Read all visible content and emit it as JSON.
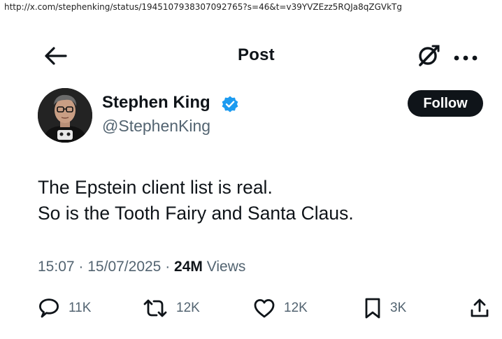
{
  "browser": {
    "url": "http://x.com/stephenking/status/1945107938307092765?s=46&t=v39YVZEzz5RQJa8qZGVkTg"
  },
  "header": {
    "title": "Post",
    "back_icon": "arrow-left-icon",
    "grok_icon": "grok-icon",
    "more_icon": "more-horizontal-icon"
  },
  "author": {
    "name": "Stephen King",
    "handle": "@StephenKing",
    "verified": true,
    "verified_color": "#1d9bf0",
    "avatar_icon": "avatar-photo"
  },
  "follow_button": {
    "label": "Follow"
  },
  "tweet": {
    "lines": [
      "The Epstein client list is real.",
      "So is the Tooth Fairy and Santa Claus."
    ]
  },
  "meta": {
    "time": "15:07",
    "separator": "·",
    "date": "15/07/2025",
    "views_count": "24M",
    "views_label": "Views"
  },
  "actions": {
    "reply": {
      "icon": "reply-icon",
      "count": "11K"
    },
    "retweet": {
      "icon": "retweet-icon",
      "count": "12K"
    },
    "like": {
      "icon": "heart-icon",
      "count": "12K"
    },
    "bookmark": {
      "icon": "bookmark-icon",
      "count": "3K"
    },
    "share": {
      "icon": "share-icon"
    }
  },
  "colors": {
    "text_primary": "#0f1419",
    "text_secondary": "#536471",
    "follow_bg": "#0f1419",
    "follow_text": "#ffffff",
    "accent": "#1d9bf0"
  }
}
